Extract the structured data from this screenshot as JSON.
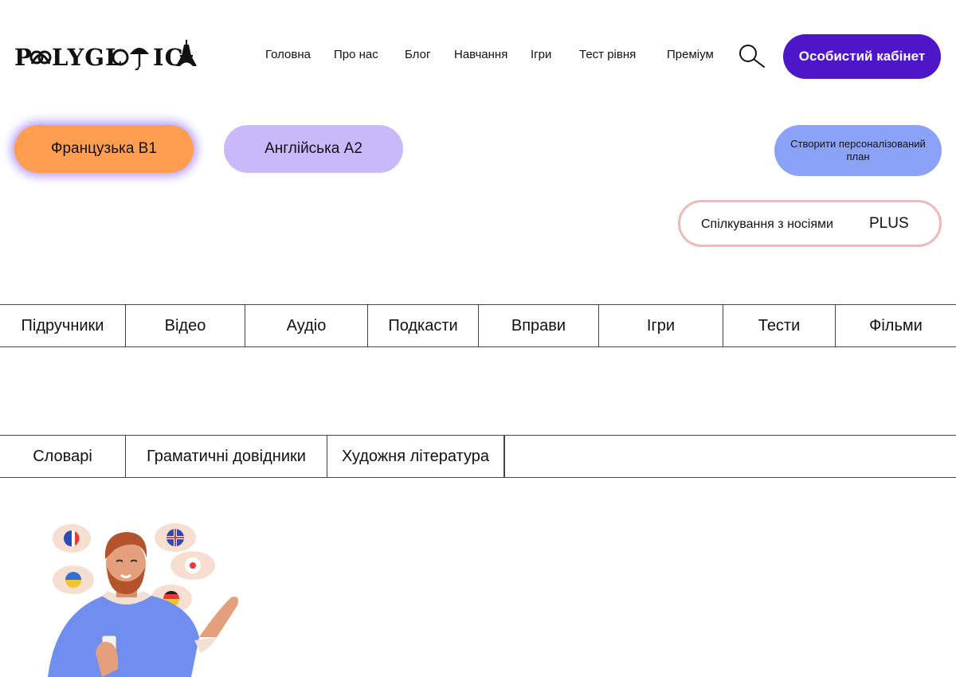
{
  "header": {
    "logo_text": "POLYGLOTICA",
    "nav": [
      "Головна",
      "Про нас",
      "Блог",
      "Навчання",
      "Ігри",
      "Тест рівня",
      "Преміум"
    ],
    "search_icon": "search-icon",
    "cabinet_label": "Особистий кабінет",
    "accent_color": "#4d17c9"
  },
  "languages": {
    "french": "Французька B1",
    "english": "Англійська A2",
    "french_color": "#ff9e50",
    "english_color": "#c9b9fb"
  },
  "actions": {
    "plan_label": "Створити персоналізований план",
    "native_label": "Спілкування з носіями",
    "native_badge": "PLUS"
  },
  "categories": {
    "row1": [
      "Підручники",
      "Відео",
      "Аудіо",
      "Подкасти",
      "Вправи",
      "Ігри",
      "Тести",
      "Фільми"
    ],
    "row2": [
      "Словарі",
      "Граматичні довідники",
      "Художня література"
    ]
  },
  "illustration": {
    "subject": "man-with-language-flags",
    "flags": [
      "france-flag",
      "uk-flag",
      "japan-flag",
      "ukraine-flag",
      "germany-flag"
    ]
  }
}
